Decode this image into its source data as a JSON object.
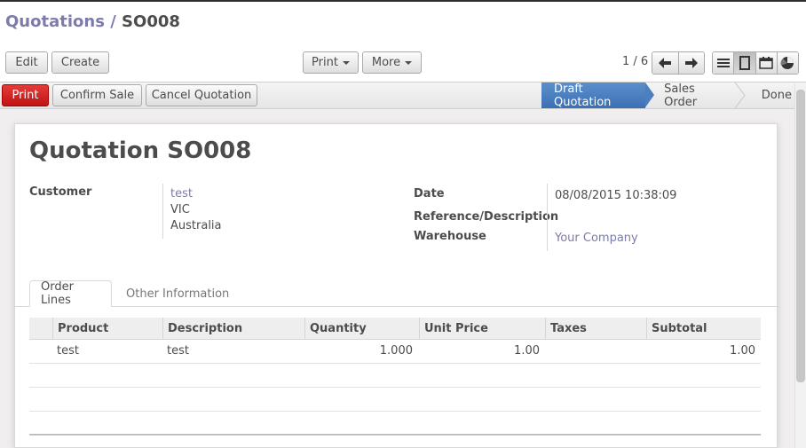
{
  "breadcrumb": {
    "parent": "Quotations",
    "separator": "/",
    "current": "SO008"
  },
  "toolbar": {
    "edit": "Edit",
    "create": "Create",
    "print": "Print",
    "more": "More"
  },
  "pager": {
    "value": "1 / 6"
  },
  "views": [
    "list-view-icon",
    "form-view-icon",
    "calendar-view-icon",
    "graph-view-icon"
  ],
  "actions": {
    "print": "Print",
    "confirm_sale": "Confirm Sale",
    "cancel_quotation": "Cancel Quotation"
  },
  "stages": {
    "draft": "Draft Quotation",
    "sales_order": "Sales Order",
    "done": "Done"
  },
  "form": {
    "title_prefix": "Quotation",
    "title_ref": "SO008",
    "customer_label": "Customer",
    "customer_name": "test",
    "customer_line2": "VIC",
    "customer_line3": "Australia",
    "date_label": "Date",
    "date_value": "08/08/2015 10:38:09",
    "reference_label": "Reference/Description",
    "reference_value": "",
    "warehouse_label": "Warehouse",
    "warehouse_value": "Your Company"
  },
  "tabs": {
    "order_lines": "Order Lines",
    "other_info": "Other Information"
  },
  "table": {
    "columns": [
      "Product",
      "Description",
      "Quantity",
      "Unit Price",
      "Taxes",
      "Subtotal"
    ],
    "rows": [
      {
        "product": "test",
        "description": "test",
        "quantity": "1.000",
        "unit_price": "1.00",
        "taxes": "",
        "subtotal": "1.00"
      }
    ]
  },
  "colors": {
    "accent": "#7c7bad",
    "print_red": "#c11414",
    "stage_active": "#4a7fc0"
  }
}
